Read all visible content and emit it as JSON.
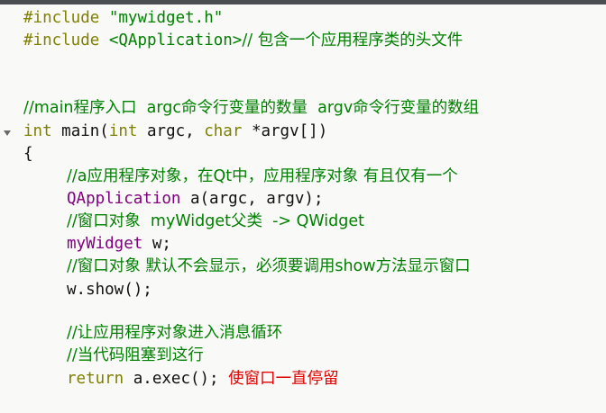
{
  "code": {
    "inc1_kw": "#include",
    "inc1_file": "\"mywidget.h\"",
    "inc2_kw": "#include",
    "inc2_file": "<QApplication>",
    "inc2_comment": "// 包含一个应用程序类的头文件",
    "main_comment": "//main程序入口  argc命令行变量的数量  argv命令行变量的数组",
    "main_int": "int",
    "main_name": "main(",
    "main_int2": "int",
    "main_argc": "argc,",
    "main_char": "char",
    "main_argv": "*argv[])",
    "brace_open": "{",
    "comment_app": "//a应用程序对象，在Qt中，应用程序对象 有且仅有一个",
    "qapp_type": "QApplication",
    "qapp_rest": "a(argc, argv);",
    "comment_window": "//窗口对象  myWidget父类  -> QWidget",
    "widget_type": "myWidget",
    "widget_rest": "w;",
    "comment_show": "//窗口对象 默认不会显示，必须要调用show方法显示窗口",
    "show_call": "w.show();",
    "comment_loop": "//让应用程序对象进入消息循环",
    "comment_block": "//当代码阻塞到这行",
    "return_kw": "return",
    "return_rest": "a.exec();",
    "return_note": "使窗口一直停留"
  }
}
